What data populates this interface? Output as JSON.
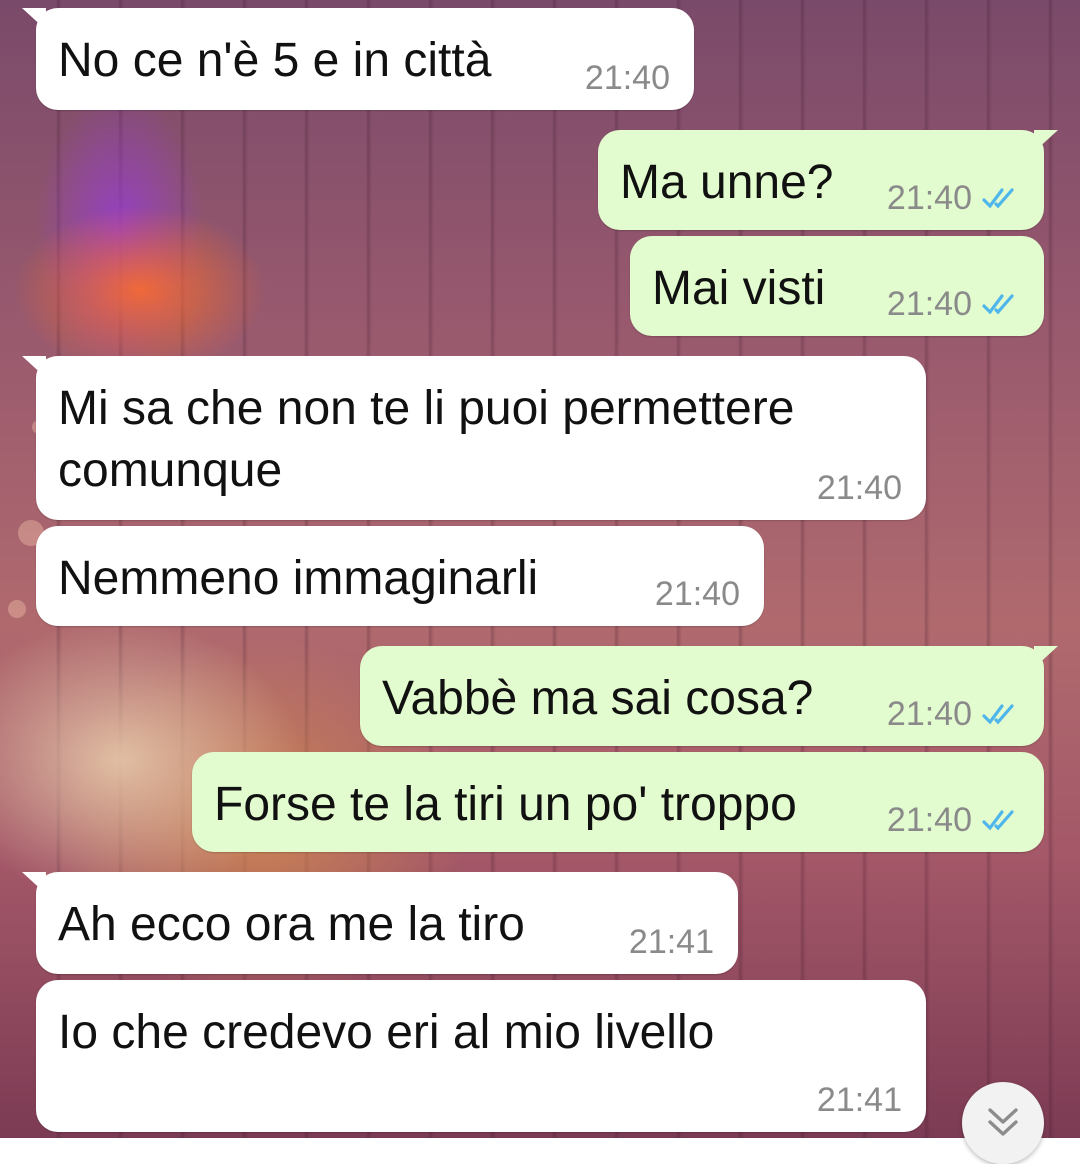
{
  "messages": [
    {
      "direction": "incoming",
      "text": "No ce n'è 5 e in città",
      "time": "21:40"
    },
    {
      "direction": "outgoing",
      "text": "Ma unne?",
      "time": "21:40",
      "status": "read"
    },
    {
      "direction": "outgoing",
      "text": "Mai visti",
      "time": "21:40",
      "status": "read"
    },
    {
      "direction": "incoming",
      "text": "Mi sa che non te li puoi permettere\ncomunque",
      "time": "21:40"
    },
    {
      "direction": "incoming",
      "text": "Nemmeno immaginarli",
      "time": "21:40"
    },
    {
      "direction": "outgoing",
      "text": "Vabbè ma sai cosa?",
      "time": "21:40",
      "status": "read"
    },
    {
      "direction": "outgoing",
      "text": "Forse te la tiri un po' troppo",
      "time": "21:40",
      "status": "read"
    },
    {
      "direction": "incoming",
      "text": "Ah ecco ora me la tiro",
      "time": "21:41"
    },
    {
      "direction": "incoming",
      "text": "Io che credevo eri al mio livello",
      "time": "21:41"
    }
  ],
  "icons": {
    "read_receipt": "double-check-icon",
    "scroll_down": "chevron-double-down-icon"
  },
  "colors": {
    "incoming_bubble": "#ffffff",
    "outgoing_bubble": "#e3fccf",
    "read_tick": "#4fb6ec",
    "timestamp": "#8a8a8a"
  }
}
